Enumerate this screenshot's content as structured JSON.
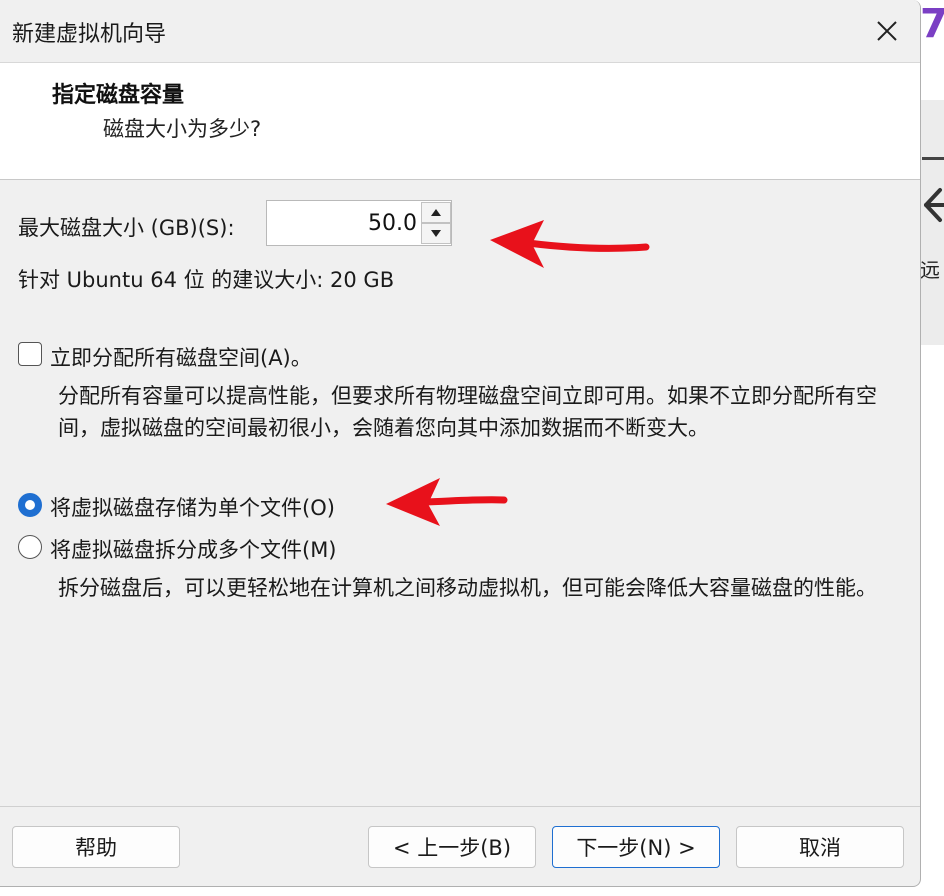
{
  "window": {
    "title": "新建虚拟机向导",
    "close_glyph": "✕"
  },
  "header": {
    "title": "指定磁盘容量",
    "subtitle": "磁盘大小为多少?"
  },
  "disk_size": {
    "label": "最大磁盘大小 (GB)(S):",
    "value": "50.0",
    "recommendation": "针对 Ubuntu 64 位 的建议大小: 20 GB"
  },
  "allocate": {
    "label": "立即分配所有磁盘空间(A)。",
    "checked": false,
    "description": "分配所有容量可以提高性能，但要求所有物理磁盘空间立即可用。如果不立即分配所有空间，虚拟磁盘的空间最初很小，会随着您向其中添加数据而不断变大。"
  },
  "storage": {
    "single_file_label": "将虚拟磁盘存储为单个文件(O)",
    "split_label": "将虚拟磁盘拆分成多个文件(M)",
    "selected": "single",
    "split_description": "拆分磁盘后，可以更轻松地在计算机之间移动虚拟机，但可能会降低大容量磁盘的性能。"
  },
  "buttons": {
    "help": "帮助",
    "back": "< 上一步(B)",
    "next": "下一步(N) >",
    "cancel": "取消"
  },
  "background": {
    "side_char": "远"
  },
  "colors": {
    "accent": "#1f6fd1",
    "annotation_arrow": "#e8111b",
    "logo": "#7b3fc4"
  }
}
